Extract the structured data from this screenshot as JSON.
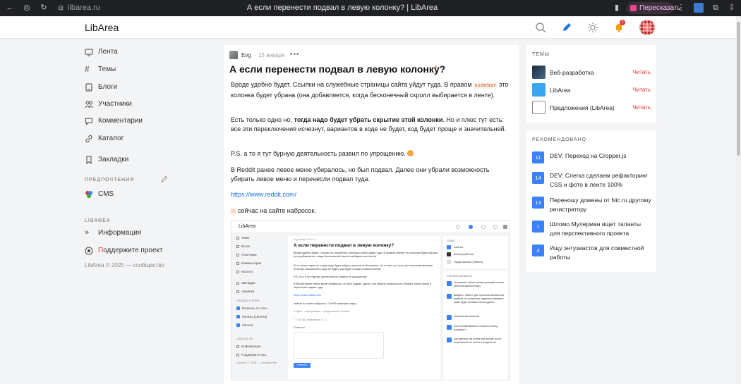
{
  "browser": {
    "url": "libarea.ru",
    "tab_title": "А если перенести подвал в левую колонку? | LibArea",
    "retell_label": "Пересказать"
  },
  "header": {
    "logo": "LibArea",
    "notification_count": "1"
  },
  "sidebar": {
    "items": [
      {
        "label": "Лента",
        "icon": "feed-icon"
      },
      {
        "label": "Темы",
        "icon": "hash-icon"
      },
      {
        "label": "Блоги",
        "icon": "blog-icon"
      },
      {
        "label": "Участники",
        "icon": "users-icon"
      },
      {
        "label": "Комментарии",
        "icon": "comment-icon"
      },
      {
        "label": "Каталог",
        "icon": "catalog-icon"
      },
      {
        "label": "Закладки",
        "icon": "bookmark-icon"
      }
    ],
    "preferences_heading": "ПРЕДПОЧТЕНИЯ",
    "cms_label": "CMS",
    "libarea_heading": "LIBAREA",
    "info_label": "Информация",
    "support_label_first": "П",
    "support_label_rest": "оддержите проект",
    "footer": "LibArea © 2025 — сообщество"
  },
  "post": {
    "author": "Evg",
    "date": "15 января",
    "more": "•••",
    "title": "А если перенести подвал в левую колонку?",
    "p1_a": "Вроде удобно будет. Ссылки на служебные страницы сайта уйдут туда. В правом ",
    "p1_code": "sidebar",
    "p1_b": " это колонка будет убрана (она добавляется, когда бесконечный скролл выбирается в ленте).",
    "p2_a": "Есть только одно но, ",
    "p2_bold": "тогда надо будет убрать скрытие этой колонки",
    "p2_b": ". Но и плюс тут есть: все эти переключения исчезнут, вариантов в коде не будет, код будет проще и значительней.",
    "p3": "P.S. а то я тут бурную деятельность развил по упрощению.",
    "p4": "В Reddit ранее левое меню убиралось, но был подвал. Далее они убрали возможность убирать левое меню и перенесли подвал туда.",
    "link": "https://www.reddit.com/",
    "p5": "сейчас на сайте набросок."
  },
  "screenshot": {
    "logo": "LibArea",
    "nav": [
      "Темы",
      "Блоги",
      "Участники",
      "Комментарии",
      "Каталог",
      "Закладки",
      "Админка"
    ],
    "pref_heading": "ПРЕДПОЧТЕНИЯ",
    "pref_items": [
      "Вопросы по LibA...",
      "Релизы (LibArea)",
      "LibArea"
    ],
    "libarea_heading": "LIBAREA.RU",
    "info_items": [
      "Информация",
      "Поддержите про..."
    ],
    "footer": "LibArea © 2025 — сообщество",
    "meta": "Evg январь 09:13 •••",
    "title": "А если перенести подвал в левую колонку?",
    "p1": "Вроде удобно будет. Ссылки на служебные страницы сайта уйдут туда. В правом sidebar это колонка будет убрана (она добавляется, когда бесконечный скролл выбирается в ленте).",
    "p2": "Есть только одно но, тогда надо будет убрать скрытие этой колонки. Но и плюс тут есть: все эти переключения исчезнут, вариантов в коде не будет, код будет проще и значительней.",
    "p3": "P.S. а то я тут бурную деятельность развил по упрощению.",
    "p4": "В Reddit ранее левое меню убиралось, но был подвал. Далее они убрали возможность убирать левое меню и перенесли подвал туда.",
    "link": "https://www.reddit.com/",
    "p5": "сейчас на сайте набросок. Ctrl+F5 возможно надо...",
    "tags": "# Идеи · информация · предложения (Svelte)",
    "actions": "♡ 0   ◎ 30                                   Отписаться   ⇪   ☐",
    "reply_label": "Ответить:",
    "submit": "Ответить",
    "topics_heading": "ТЕМЫ",
    "topics": [
      "LibArea",
      "Веб-разработка",
      "Предложения (LibArea)"
    ],
    "rec_heading": "РЕКОМЕНДОВАНО",
    "recs": [
      "Установка LibArea на виртуальный хостинг (бесплатный/платный)",
      "Введите \"обмен\" для хранения временных файлов, по истечении заданного времени файл будет автоматически удален",
      "Отключение каталога",
      "how to install libarea on shared hosting, localnginx ?",
      "Как сделать так чтобы при заходе после открывались из ленты в разделе all"
    ]
  },
  "right": {
    "topics_heading": "ТЕМЫ",
    "topics": [
      {
        "name": "Веб-разработка",
        "action": "Читать"
      },
      {
        "name": "LibArea",
        "action": "Читать"
      },
      {
        "name": "Предложения (LibArea)",
        "action": "Читать"
      }
    ],
    "rec_heading": "РЕКОМЕНДОВАНО",
    "recs": [
      {
        "num": "11",
        "text": "DEV: Переход на Cropper.js"
      },
      {
        "num": "14",
        "text": "DEV: Слегка сделаем рефакторинг CSS и фото в ленте 100%"
      },
      {
        "num": "13",
        "text": "Переношу домены от Nic.ru другому регистратору"
      },
      {
        "num": "1",
        "text": "Шломо Мулерман ищет таланты для перспективного проекта"
      },
      {
        "num": "4",
        "text": "Ищу энтузиастов для совместной работы"
      }
    ]
  },
  "colors": {
    "accent": "#3b82f6",
    "read_link": "#e53935",
    "link": "#1a73e8"
  }
}
